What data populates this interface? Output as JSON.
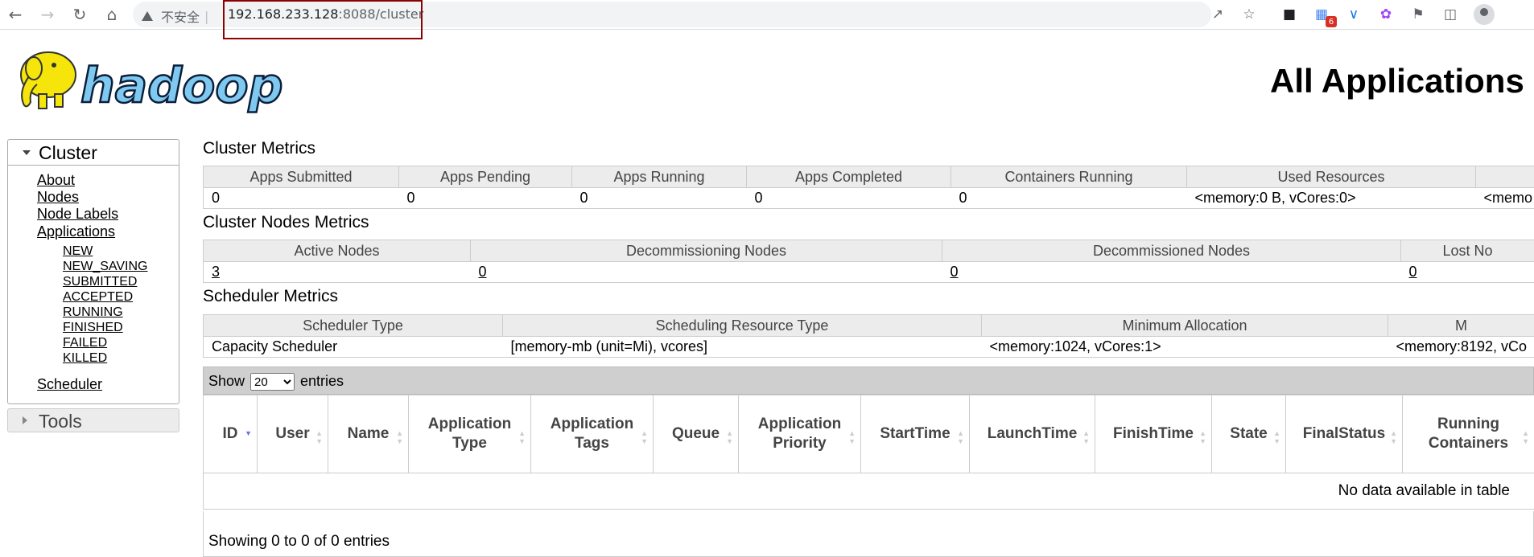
{
  "browser": {
    "security_label": "不安全",
    "url_host": "192.168.233.128",
    "url_rest": ":8088/cluster",
    "extension_badge": "6"
  },
  "header": {
    "logo_text": "hadoop",
    "title": "All Applications"
  },
  "sidebar": {
    "cluster_label": "Cluster",
    "links": [
      "About",
      "Nodes",
      "Node Labels",
      "Applications"
    ],
    "app_states": [
      "NEW",
      "NEW_SAVING",
      "SUBMITTED",
      "ACCEPTED",
      "RUNNING",
      "FINISHED",
      "FAILED",
      "KILLED"
    ],
    "scheduler": "Scheduler",
    "tools_label": "Tools"
  },
  "cluster_metrics": {
    "title": "Cluster Metrics",
    "headers": [
      "Apps Submitted",
      "Apps Pending",
      "Apps Running",
      "Apps Completed",
      "Containers Running",
      "Used Resources",
      ""
    ],
    "values": [
      "0",
      "0",
      "0",
      "0",
      "0",
      "<memory:0 B, vCores:0>",
      "<memo"
    ]
  },
  "nodes_metrics": {
    "title": "Cluster Nodes Metrics",
    "headers": [
      "Active Nodes",
      "Decommissioning Nodes",
      "Decommissioned Nodes",
      "Lost No"
    ],
    "values": [
      "3",
      "0",
      "0",
      "0"
    ]
  },
  "scheduler_metrics": {
    "title": "Scheduler Metrics",
    "headers": [
      "Scheduler Type",
      "Scheduling Resource Type",
      "Minimum Allocation",
      "M"
    ],
    "values": [
      "Capacity Scheduler",
      "[memory-mb (unit=Mi), vcores]",
      "<memory:1024, vCores:1>",
      "<memory:8192, vCo"
    ]
  },
  "apps_table": {
    "show_label": "Show",
    "page_size": "20",
    "page_size_options": [
      "20"
    ],
    "entries_label": "entries",
    "columns": [
      "ID",
      "User",
      "Name",
      "Application Type",
      "Application Tags",
      "Queue",
      "Application Priority",
      "StartTime",
      "LaunchTime",
      "FinishTime",
      "State",
      "FinalStatus",
      "Running Containers"
    ],
    "empty_message": "No data available in table",
    "footer": "Showing 0 to 0 of 0 entries"
  }
}
